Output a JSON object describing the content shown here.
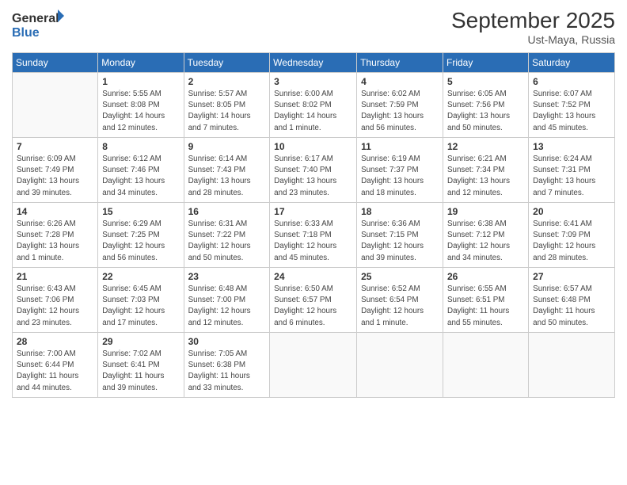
{
  "logo": {
    "line1": "General",
    "line2": "Blue"
  },
  "title": "September 2025",
  "subtitle": "Ust-Maya, Russia",
  "days_of_week": [
    "Sunday",
    "Monday",
    "Tuesday",
    "Wednesday",
    "Thursday",
    "Friday",
    "Saturday"
  ],
  "weeks": [
    [
      {
        "day": "",
        "info": ""
      },
      {
        "day": "1",
        "info": "Sunrise: 5:55 AM\nSunset: 8:08 PM\nDaylight: 14 hours\nand 12 minutes."
      },
      {
        "day": "2",
        "info": "Sunrise: 5:57 AM\nSunset: 8:05 PM\nDaylight: 14 hours\nand 7 minutes."
      },
      {
        "day": "3",
        "info": "Sunrise: 6:00 AM\nSunset: 8:02 PM\nDaylight: 14 hours\nand 1 minute."
      },
      {
        "day": "4",
        "info": "Sunrise: 6:02 AM\nSunset: 7:59 PM\nDaylight: 13 hours\nand 56 minutes."
      },
      {
        "day": "5",
        "info": "Sunrise: 6:05 AM\nSunset: 7:56 PM\nDaylight: 13 hours\nand 50 minutes."
      },
      {
        "day": "6",
        "info": "Sunrise: 6:07 AM\nSunset: 7:52 PM\nDaylight: 13 hours\nand 45 minutes."
      }
    ],
    [
      {
        "day": "7",
        "info": "Sunrise: 6:09 AM\nSunset: 7:49 PM\nDaylight: 13 hours\nand 39 minutes."
      },
      {
        "day": "8",
        "info": "Sunrise: 6:12 AM\nSunset: 7:46 PM\nDaylight: 13 hours\nand 34 minutes."
      },
      {
        "day": "9",
        "info": "Sunrise: 6:14 AM\nSunset: 7:43 PM\nDaylight: 13 hours\nand 28 minutes."
      },
      {
        "day": "10",
        "info": "Sunrise: 6:17 AM\nSunset: 7:40 PM\nDaylight: 13 hours\nand 23 minutes."
      },
      {
        "day": "11",
        "info": "Sunrise: 6:19 AM\nSunset: 7:37 PM\nDaylight: 13 hours\nand 18 minutes."
      },
      {
        "day": "12",
        "info": "Sunrise: 6:21 AM\nSunset: 7:34 PM\nDaylight: 13 hours\nand 12 minutes."
      },
      {
        "day": "13",
        "info": "Sunrise: 6:24 AM\nSunset: 7:31 PM\nDaylight: 13 hours\nand 7 minutes."
      }
    ],
    [
      {
        "day": "14",
        "info": "Sunrise: 6:26 AM\nSunset: 7:28 PM\nDaylight: 13 hours\nand 1 minute."
      },
      {
        "day": "15",
        "info": "Sunrise: 6:29 AM\nSunset: 7:25 PM\nDaylight: 12 hours\nand 56 minutes."
      },
      {
        "day": "16",
        "info": "Sunrise: 6:31 AM\nSunset: 7:22 PM\nDaylight: 12 hours\nand 50 minutes."
      },
      {
        "day": "17",
        "info": "Sunrise: 6:33 AM\nSunset: 7:18 PM\nDaylight: 12 hours\nand 45 minutes."
      },
      {
        "day": "18",
        "info": "Sunrise: 6:36 AM\nSunset: 7:15 PM\nDaylight: 12 hours\nand 39 minutes."
      },
      {
        "day": "19",
        "info": "Sunrise: 6:38 AM\nSunset: 7:12 PM\nDaylight: 12 hours\nand 34 minutes."
      },
      {
        "day": "20",
        "info": "Sunrise: 6:41 AM\nSunset: 7:09 PM\nDaylight: 12 hours\nand 28 minutes."
      }
    ],
    [
      {
        "day": "21",
        "info": "Sunrise: 6:43 AM\nSunset: 7:06 PM\nDaylight: 12 hours\nand 23 minutes."
      },
      {
        "day": "22",
        "info": "Sunrise: 6:45 AM\nSunset: 7:03 PM\nDaylight: 12 hours\nand 17 minutes."
      },
      {
        "day": "23",
        "info": "Sunrise: 6:48 AM\nSunset: 7:00 PM\nDaylight: 12 hours\nand 12 minutes."
      },
      {
        "day": "24",
        "info": "Sunrise: 6:50 AM\nSunset: 6:57 PM\nDaylight: 12 hours\nand 6 minutes."
      },
      {
        "day": "25",
        "info": "Sunrise: 6:52 AM\nSunset: 6:54 PM\nDaylight: 12 hours\nand 1 minute."
      },
      {
        "day": "26",
        "info": "Sunrise: 6:55 AM\nSunset: 6:51 PM\nDaylight: 11 hours\nand 55 minutes."
      },
      {
        "day": "27",
        "info": "Sunrise: 6:57 AM\nSunset: 6:48 PM\nDaylight: 11 hours\nand 50 minutes."
      }
    ],
    [
      {
        "day": "28",
        "info": "Sunrise: 7:00 AM\nSunset: 6:44 PM\nDaylight: 11 hours\nand 44 minutes."
      },
      {
        "day": "29",
        "info": "Sunrise: 7:02 AM\nSunset: 6:41 PM\nDaylight: 11 hours\nand 39 minutes."
      },
      {
        "day": "30",
        "info": "Sunrise: 7:05 AM\nSunset: 6:38 PM\nDaylight: 11 hours\nand 33 minutes."
      },
      {
        "day": "",
        "info": ""
      },
      {
        "day": "",
        "info": ""
      },
      {
        "day": "",
        "info": ""
      },
      {
        "day": "",
        "info": ""
      }
    ]
  ]
}
